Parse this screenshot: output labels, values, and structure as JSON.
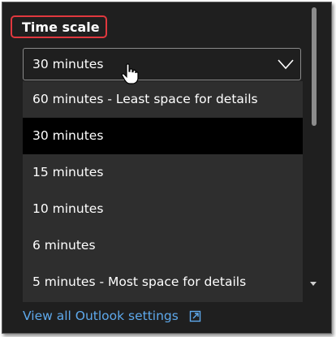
{
  "section": {
    "title": "Time scale"
  },
  "select": {
    "value": "30 minutes"
  },
  "options": [
    {
      "label": "60 minutes - Least space for details",
      "selected": false
    },
    {
      "label": "30 minutes",
      "selected": true
    },
    {
      "label": "15 minutes",
      "selected": false
    },
    {
      "label": "10 minutes",
      "selected": false
    },
    {
      "label": "6 minutes",
      "selected": false
    },
    {
      "label": "5 minutes - Most space for details",
      "selected": false
    }
  ],
  "footer": {
    "link_label": "View all Outlook settings",
    "link_icon": "open-in-new-window-icon"
  },
  "colors": {
    "background": "#1f1f1f",
    "dropdown": "#2e2e2e",
    "selected": "#000000",
    "link": "#5ea9ec",
    "highlight": "#e0383e"
  }
}
